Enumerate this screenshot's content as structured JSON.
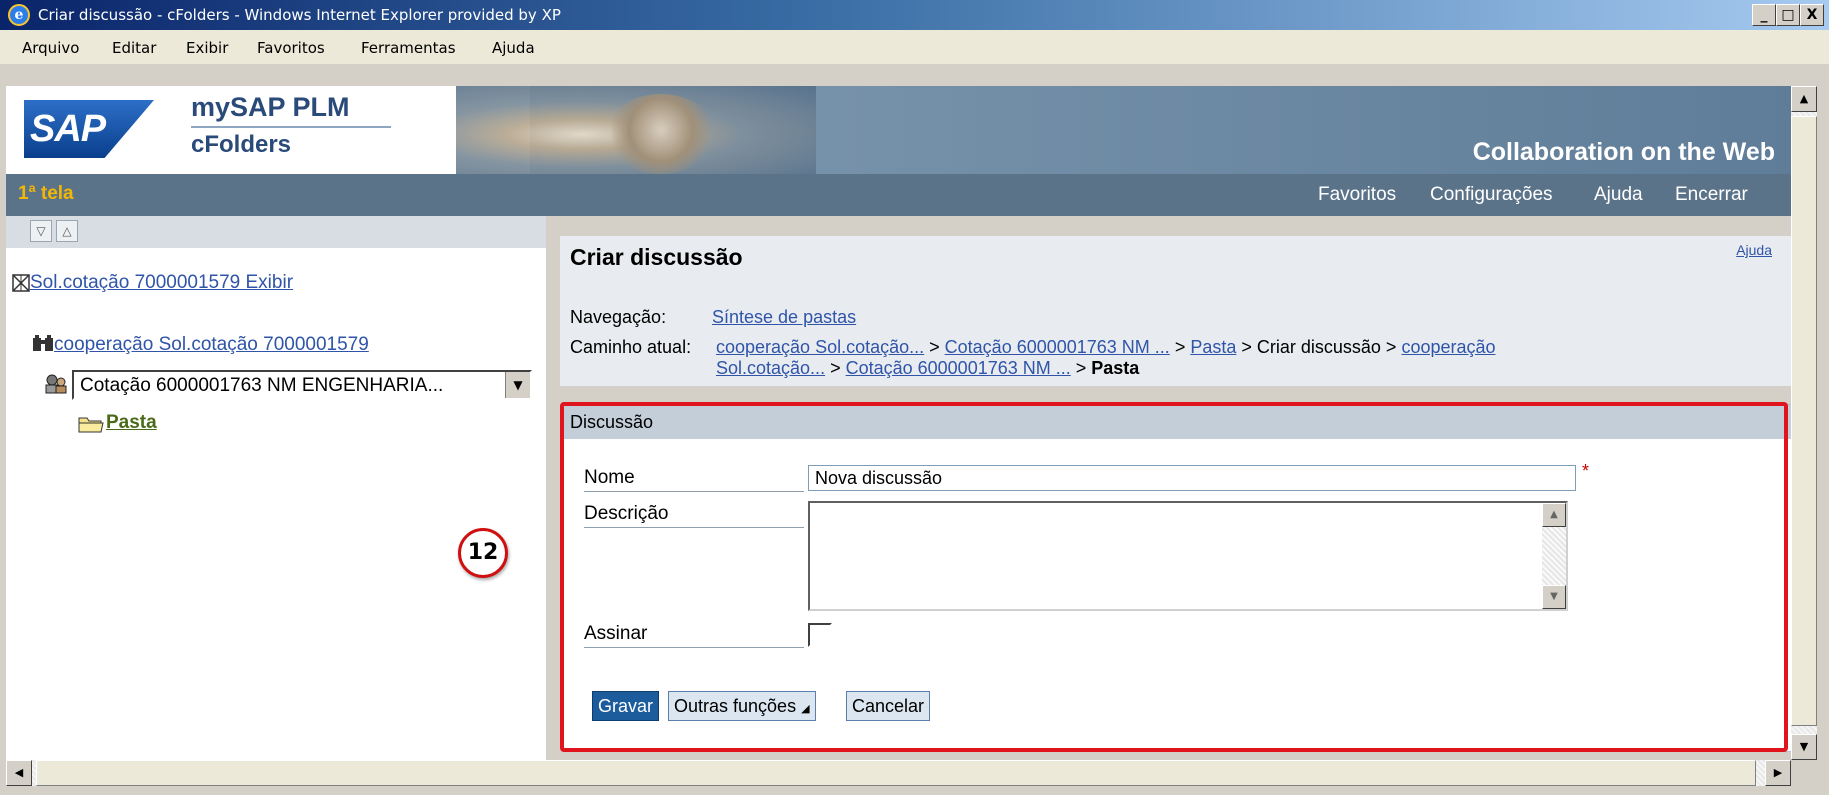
{
  "window": {
    "title": "Criar discussão - cFolders - Windows Internet Explorer provided by XP",
    "buttons": [
      "_",
      "□",
      "X"
    ]
  },
  "menu": {
    "items": [
      "Arquivo",
      "Editar",
      "Exibir",
      "Favoritos",
      "Ferramentas",
      "Ajuda"
    ]
  },
  "header": {
    "logo": "SAP",
    "product_line1": "mySAP PLM",
    "product_line2": "cFolders",
    "tagline": "Collaboration on the Web"
  },
  "navbar": {
    "screen_name": "1ª tela",
    "links": [
      "Favoritos",
      "Configurações",
      "Ajuda",
      "Encerrar"
    ]
  },
  "tree": {
    "toolbar_icons": [
      "expand-all-icon",
      "collapse-all-icon"
    ],
    "root_link": "Sol.cotação 7000001579 Exibir",
    "cooperation_link": "cooperação Sol.cotação 7000001579",
    "selected_quote": "Cotação 6000001763 NM ENGENHARIA...",
    "folder_link": "Pasta"
  },
  "content": {
    "title": "Criar discussão",
    "help": "Ajuda",
    "nav_label": "Navegação:",
    "nav_link": "Síntese de pastas",
    "path_label": "Caminho atual:",
    "path": {
      "p1": "cooperação Sol.cotação...",
      "sep1": " > ",
      "p2": "Cotação 6000001763 NM ...",
      "sep2": " > ",
      "p3": "Pasta",
      "sep3": " > Criar discussão > ",
      "p4a": "cooperação",
      "p4b": "Sol.cotação...",
      "sep4": " > ",
      "p5": "Cotação 6000001763 NM ...",
      "sep5": " > ",
      "current": "Pasta"
    }
  },
  "discussion": {
    "header": "Discussão",
    "name_label": "Nome",
    "name_value": "Nova discussão",
    "required_mark": "*",
    "desc_label": "Descrição",
    "sign_label": "Assinar",
    "sign_checked": false,
    "buttons": {
      "save": "Gravar",
      "more": "Outras funções",
      "cancel": "Cancelar"
    }
  },
  "annotation": {
    "step": "12",
    "highlight_color": "#e0141c"
  },
  "colors": {
    "nav_bg": "#5b7389",
    "screen_name": "#f2b705",
    "link": "#2f54a8",
    "primary_button": "#1c5c9c"
  }
}
